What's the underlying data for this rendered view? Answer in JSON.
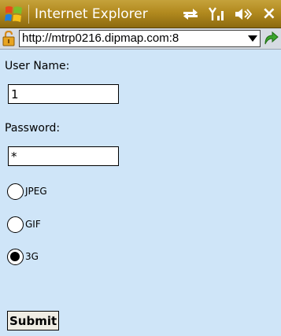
{
  "titlebar": {
    "app_title": "Internet Explorer",
    "icons": [
      "windows-logo-icon",
      "data-connection-icon",
      "signal-icon",
      "volume-icon",
      "close-icon"
    ],
    "close_label": "×"
  },
  "addressbar": {
    "url": "http://mtrp0216.dipmap.com:8",
    "icons": [
      "lock-icon",
      "dropdown-icon",
      "go-icon"
    ]
  },
  "form": {
    "username_label": "User Name:",
    "username_value": "1",
    "password_label": "Password:",
    "password_value": "*",
    "format_options": [
      {
        "label": "JPEG",
        "checked": false
      },
      {
        "label": "GIF",
        "checked": false
      },
      {
        "label": "3G",
        "checked": true
      }
    ],
    "submit_label": "Submit"
  },
  "colors": {
    "titlebar": "#b28a1f",
    "content_bg": "#cfe5f8"
  }
}
